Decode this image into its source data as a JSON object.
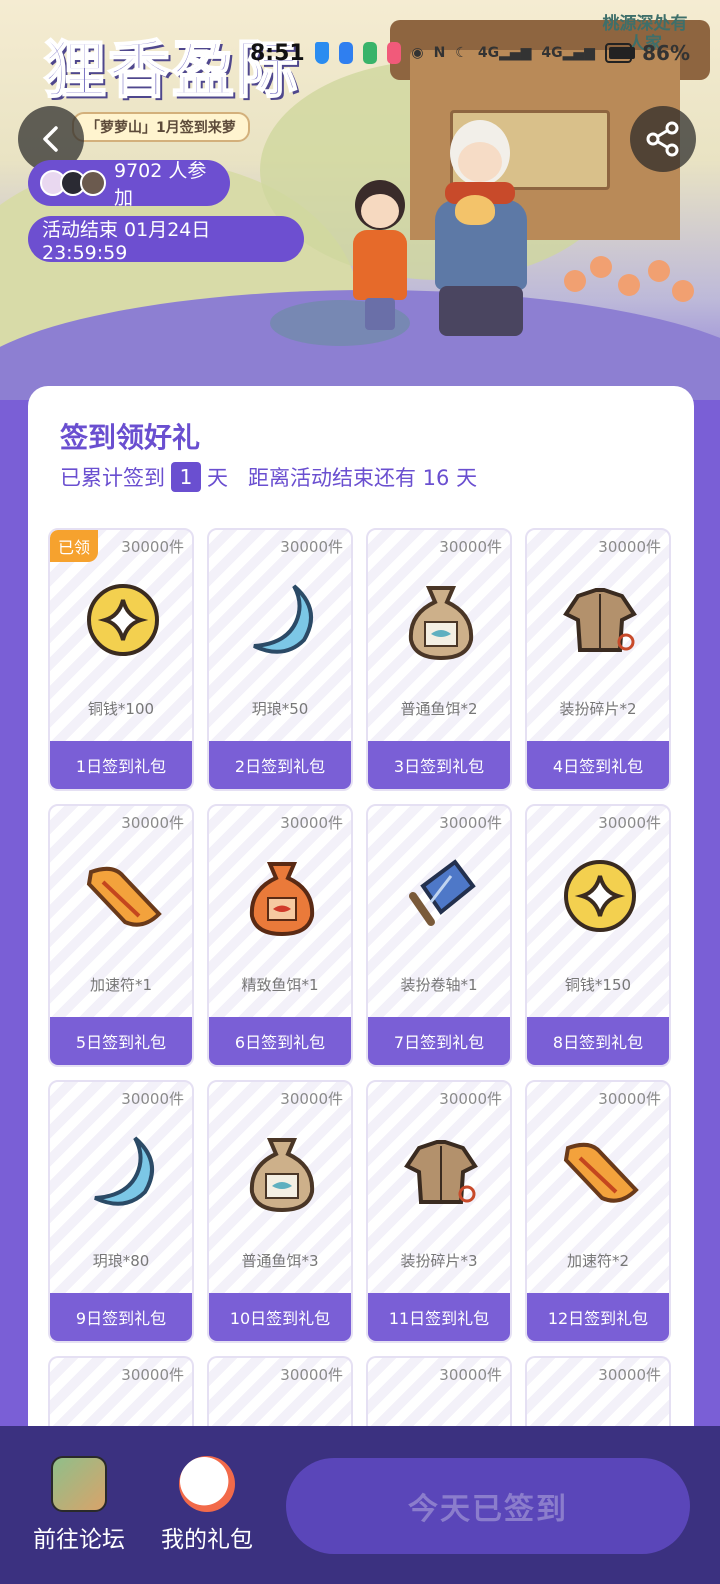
{
  "status_bar": {
    "time": "8:51",
    "battery": "86%"
  },
  "banner": {
    "logo_title": "狸香盈际",
    "logo_subtitle": "「萝萝山」1月签到来萝",
    "corner_logo": "桃源深处有人家",
    "participants": "9702 人参加",
    "end_time": "活动结束 01月24日 23:59:59"
  },
  "card": {
    "title": "签到领好礼",
    "sub_prefix": "已累计签到",
    "days_signed": "1",
    "sub_days_unit": "天",
    "sub_remaining": "距离活动结束还有 16 天"
  },
  "claimed_tag": "已领",
  "gifts": [
    {
      "stock": "30000件",
      "item": "铜钱*100",
      "label": "1日签到礼包",
      "icon": "copper-coin"
    },
    {
      "stock": "30000件",
      "item": "玥琅*50",
      "label": "2日签到礼包",
      "icon": "crescent-gem"
    },
    {
      "stock": "30000件",
      "item": "普通鱼饵*2",
      "label": "3日签到礼包",
      "icon": "bait-bag"
    },
    {
      "stock": "30000件",
      "item": "装扮碎片*2",
      "label": "4日签到礼包",
      "icon": "outfit-fragment"
    },
    {
      "stock": "30000件",
      "item": "加速符*1",
      "label": "5日签到礼包",
      "icon": "speed-talisman"
    },
    {
      "stock": "30000件",
      "item": "精致鱼饵*1",
      "label": "6日签到礼包",
      "icon": "fine-bait-bag"
    },
    {
      "stock": "30000件",
      "item": "装扮卷轴*1",
      "label": "7日签到礼包",
      "icon": "outfit-scroll"
    },
    {
      "stock": "30000件",
      "item": "铜钱*150",
      "label": "8日签到礼包",
      "icon": "copper-coin"
    },
    {
      "stock": "30000件",
      "item": "玥琅*80",
      "label": "9日签到礼包",
      "icon": "crescent-gem"
    },
    {
      "stock": "30000件",
      "item": "普通鱼饵*3",
      "label": "10日签到礼包",
      "icon": "bait-bag"
    },
    {
      "stock": "30000件",
      "item": "装扮碎片*3",
      "label": "11日签到礼包",
      "icon": "outfit-fragment"
    },
    {
      "stock": "30000件",
      "item": "加速符*2",
      "label": "12日签到礼包",
      "icon": "speed-talisman"
    },
    {
      "stock": "30000件"
    },
    {
      "stock": "30000件"
    },
    {
      "stock": "30000件"
    },
    {
      "stock": "30000件"
    }
  ],
  "bottom_bar": {
    "forum_label": "前往论坛",
    "gift_label": "我的礼包",
    "sign_button": "今天已签到"
  },
  "colors": {
    "accent": "#7a5fd6",
    "claimed": "#f6a22e",
    "bottom_bar": "#3b3180"
  }
}
